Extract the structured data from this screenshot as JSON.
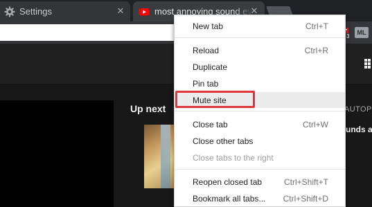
{
  "tabs": [
    {
      "title": "Settings",
      "icon": "gear-icon"
    },
    {
      "title": "most annoying sound ever",
      "icon": "youtube-icon"
    }
  ],
  "extensions": {
    "badge": "3",
    "ml_label": "ML"
  },
  "page": {
    "up_next": "Up next",
    "autoplay": "AUTOPLAY",
    "rec_title": "unds a"
  },
  "menu": {
    "new_tab": {
      "label": "New tab",
      "shortcut": "Ctrl+T"
    },
    "reload": {
      "label": "Reload",
      "shortcut": "Ctrl+R"
    },
    "duplicate": {
      "label": "Duplicate"
    },
    "pin_tab": {
      "label": "Pin tab"
    },
    "mute_site": {
      "label": "Mute site",
      "highlighted": true
    },
    "close_tab": {
      "label": "Close tab",
      "shortcut": "Ctrl+W"
    },
    "close_other_tabs": {
      "label": "Close other tabs"
    },
    "close_tabs_right": {
      "label": "Close tabs to the right",
      "disabled": true
    },
    "reopen_closed_tab": {
      "label": "Reopen closed tab",
      "shortcut": "Ctrl+Shift+T"
    },
    "bookmark_all_tabs": {
      "label": "Bookmark all tabs...",
      "shortcut": "Ctrl+Shift+D"
    }
  },
  "colors": {
    "highlight_box": "#e2353a",
    "youtube_red": "#ff0000"
  }
}
